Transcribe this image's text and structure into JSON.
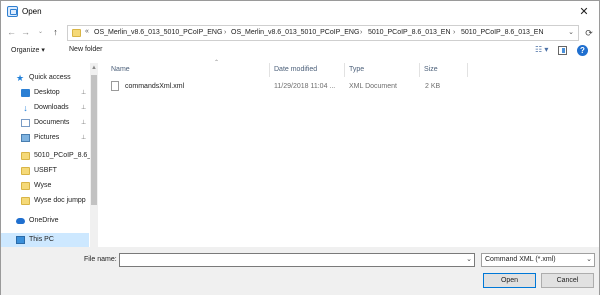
{
  "window": {
    "title": "Open",
    "close_glyph": "✕"
  },
  "nav": {
    "back_glyph": "←",
    "forward_glyph": "→",
    "recent_glyph": "⌄",
    "up_glyph": "↑",
    "refresh_glyph": "⟳"
  },
  "address": {
    "overflow_glyph": "«",
    "crumbs": [
      "OS_Merlin_v8.6_013_5010_PCoIP_ENG",
      "OS_Merlin_v8.6_013_5010_PCoIP_ENG",
      "5010_PCoIP_8.6_013_EN",
      "5010_PCoIP_8.6_013_EN"
    ],
    "separator": "›",
    "dropdown_glyph": "⌄"
  },
  "toolbar": {
    "organize_label": "Organize ▾",
    "new_folder_label": "New folder",
    "view_glyph": "☷ ▾",
    "help_glyph": "?"
  },
  "navpane": {
    "items": [
      {
        "label": "Quick access",
        "icon": "star-icon",
        "pinned": false
      },
      {
        "label": "Desktop",
        "icon": "desktop-icon",
        "pinned": true
      },
      {
        "label": "Downloads",
        "icon": "downloads-icon",
        "pinned": true
      },
      {
        "label": "Documents",
        "icon": "documents-icon",
        "pinned": true
      },
      {
        "label": "Pictures",
        "icon": "pictures-icon",
        "pinned": true
      },
      {
        "label": "5010_PCoIP_8.6_",
        "icon": "folder-icon",
        "pinned": false
      },
      {
        "label": "USBFT",
        "icon": "folder-icon",
        "pinned": false
      },
      {
        "label": "Wyse",
        "icon": "folder-icon",
        "pinned": false
      },
      {
        "label": "Wyse doc jumpp",
        "icon": "folder-icon",
        "pinned": false
      },
      {
        "label": "OneDrive",
        "icon": "cloud-icon",
        "pinned": false
      },
      {
        "label": "This PC",
        "icon": "computer-icon",
        "pinned": false
      }
    ],
    "pin_glyph": "📌",
    "selected": "This PC"
  },
  "filelist": {
    "columns": [
      "Name",
      "Date modified",
      "Type",
      "Size"
    ],
    "files": [
      {
        "name": "commandsXml.xml",
        "date": "11/29/2018 11:04 ...",
        "type": "XML Document",
        "size": "2 KB"
      }
    ]
  },
  "footer": {
    "filename_label": "File name:",
    "filename_value": "",
    "filetype_value": "Command XML (*.xml)",
    "open_label": "Open",
    "cancel_label": "Cancel",
    "dropdown_glyph": "⌄"
  }
}
